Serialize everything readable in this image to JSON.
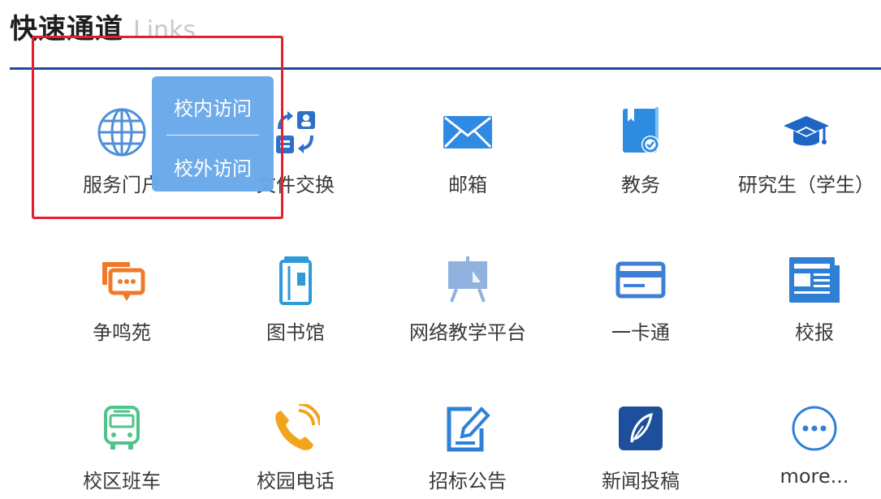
{
  "section": {
    "title": "快速通道",
    "subtitle": "Links"
  },
  "popup": {
    "option_internal": "校内访问",
    "option_external": "校外访问"
  },
  "links": [
    {
      "label": "服务门户",
      "icon": "globe-icon",
      "color": "#4f8fd9"
    },
    {
      "label": "文件交换",
      "icon": "file-exchange-icon",
      "color": "#2e6fc9"
    },
    {
      "label": "邮箱",
      "icon": "mail-icon",
      "color": "#2f8ae3"
    },
    {
      "label": "教务",
      "icon": "academic-book-icon",
      "color": "#2d8be0"
    },
    {
      "label": "研究生（学生）",
      "icon": "graduation-cap-icon",
      "color": "#1e66c6"
    },
    {
      "label": "争鸣苑",
      "icon": "chat-bubbles-icon",
      "color": "#f07a2a"
    },
    {
      "label": "图书馆",
      "icon": "library-book-icon",
      "color": "#2f9ad8"
    },
    {
      "label": "网络教学平台",
      "icon": "teaching-board-icon",
      "color": "#8fb3de"
    },
    {
      "label": "一卡通",
      "icon": "card-icon",
      "color": "#3e7fd6"
    },
    {
      "label": "校报",
      "icon": "newspaper-icon",
      "color": "#2f7fd4"
    },
    {
      "label": "校区班车",
      "icon": "bus-icon",
      "color": "#4fc48a"
    },
    {
      "label": "校园电话",
      "icon": "phone-icon",
      "color": "#f2a51c"
    },
    {
      "label": "招标公告",
      "icon": "edit-document-icon",
      "color": "#2f80d9"
    },
    {
      "label": "新闻投稿",
      "icon": "feather-pen-icon",
      "color": "#1d4f9c"
    },
    {
      "label": "more...",
      "icon": "more-icon",
      "color": "#2f80d9"
    }
  ]
}
